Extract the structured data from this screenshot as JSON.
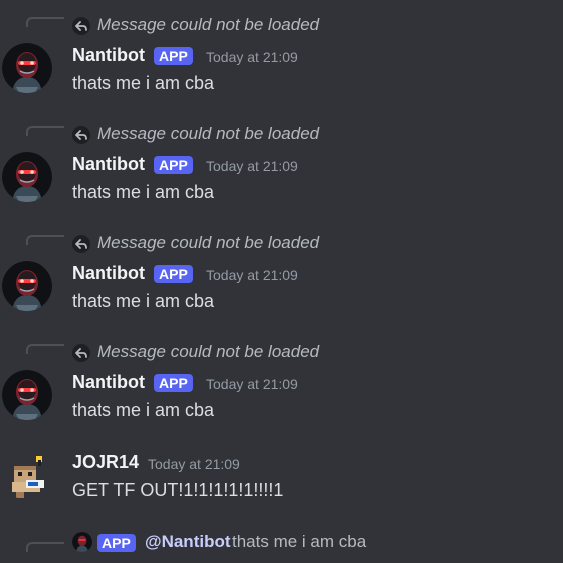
{
  "messages": [
    {
      "reply": {
        "text": "Message could not be loaded",
        "icon": "reply-arrow-icon"
      },
      "author": "Nantibot",
      "badge": "APP",
      "timestamp": "Today at 21:09",
      "content": "thats me i am cba",
      "avatar": "robot-avatar"
    },
    {
      "reply": {
        "text": "Message could not be loaded",
        "icon": "reply-arrow-icon"
      },
      "author": "Nantibot",
      "badge": "APP",
      "timestamp": "Today at 21:09",
      "content": "thats me i am cba",
      "avatar": "robot-avatar"
    },
    {
      "reply": {
        "text": "Message could not be loaded",
        "icon": "reply-arrow-icon"
      },
      "author": "Nantibot",
      "badge": "APP",
      "timestamp": "Today at 21:09",
      "content": "thats me i am cba",
      "avatar": "robot-avatar"
    },
    {
      "reply": {
        "text": "Message could not be loaded",
        "icon": "reply-arrow-icon"
      },
      "author": "Nantibot",
      "badge": "APP",
      "timestamp": "Today at 21:09",
      "content": "thats me i am cba",
      "avatar": "robot-avatar"
    },
    {
      "author": "JOJR14",
      "timestamp": "Today at 21:09",
      "content": "GET TF OUT!1!1!1!1!1!!!!1",
      "avatar": "pixel-character-avatar"
    }
  ],
  "partial_reply": {
    "badge": "APP",
    "mention": "@Nantibot",
    "text": "thats me i am cba"
  },
  "colors": {
    "background": "#313338",
    "badge": "#5865f2",
    "username": "#f2f3f5",
    "timestamp": "#949ba4",
    "content": "#dbdee1",
    "reply_text": "#b5bac1",
    "mention": "#c9cdfb"
  }
}
